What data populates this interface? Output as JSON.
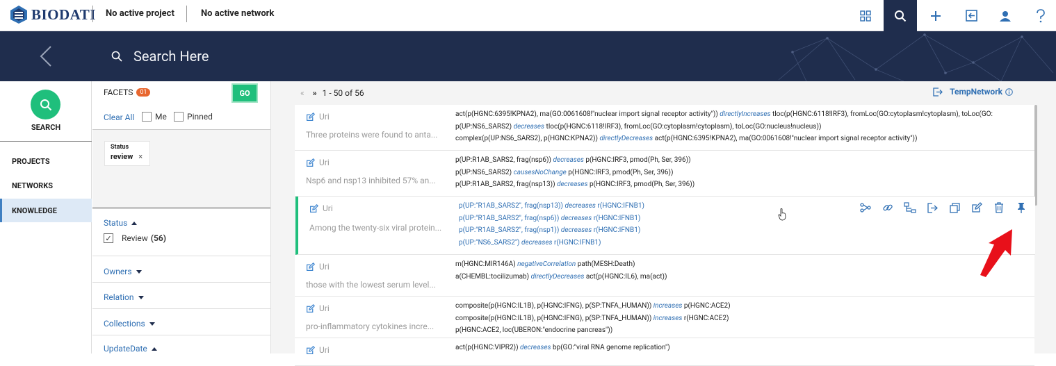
{
  "app": {
    "logo_text": "BIODATI",
    "project": "No active project",
    "network": "No active network"
  },
  "toolbar_icons": [
    "grid-icon",
    "search-icon",
    "plus-icon",
    "import-icon",
    "user-icon",
    "help-icon"
  ],
  "header": {
    "search_placeholder": "Search Here"
  },
  "leftnav": {
    "search_label": "SEARCH",
    "items": [
      {
        "label": "PROJECTS"
      },
      {
        "label": "NETWORKS"
      },
      {
        "label": "KNOWLEDGE"
      }
    ]
  },
  "facets": {
    "title": "FACETS",
    "count": "01",
    "go_label": "GO",
    "clear_all": "Clear All",
    "me_label": "Me",
    "pinned_label": "Pinned",
    "chip": {
      "key": "Status",
      "value": "review",
      "remove": "×"
    },
    "sections": [
      {
        "title": "Status",
        "expanded": true
      },
      {
        "title": "Owners",
        "expanded": false
      },
      {
        "title": "Relation",
        "expanded": false
      },
      {
        "title": "Collections",
        "expanded": false
      },
      {
        "title": "UpdateDate",
        "expanded": true
      }
    ],
    "status_option": {
      "label": "Review",
      "count": "(56)",
      "check": "✓"
    }
  },
  "results": {
    "pager_prev": "«",
    "pager_next": "»",
    "range": "1 - 50 of 56",
    "temp_network": "TempNetwork",
    "rows": [
      {
        "owner": "Uri",
        "summary": "Three proteins were found to anta...",
        "lines": [
          [
            {
              "t": "act(p(HGNC:6395!KPNA2), ma(GO:0061608!\"nuclear import signal receptor activity\")) "
            },
            {
              "t": "directlyIncreases",
              "rel": true
            },
            {
              "t": " tloc(p(HGNC:6118!IRF3), fromLoc(GO:cytoplasm!cytoplasm), toLoc(GO:"
            }
          ],
          [
            {
              "t": "p(UP:NS6_SARS2) "
            },
            {
              "t": "decreases",
              "rel": true
            },
            {
              "t": " tloc(p(HGNC:6118!IRF3), fromLoc(GO:cytoplasm!cytoplasm), toLoc(GO:nucleus!nucleus))"
            }
          ],
          [
            {
              "t": "complex(p(UP:NS6_SARS2), p(HGNC:KPNA2)) "
            },
            {
              "t": "directlyDecreases",
              "rel": true
            },
            {
              "t": " act(p(HGNC:6395!KPNA2), ma(GO:0061608!\"nuclear import signal receptor activity\"))"
            }
          ]
        ]
      },
      {
        "owner": "Uri",
        "summary": "Nsp6 and nsp13 inhibited 57% an...",
        "lines": [
          [
            {
              "t": "p(UP:R1AB_SARS2, frag(nsp6)) "
            },
            {
              "t": "decreases",
              "rel": true
            },
            {
              "t": " p(HGNC:IRF3, pmod(Ph, Ser, 396))"
            }
          ],
          [
            {
              "t": "p(UP:NS6_SARS2) "
            },
            {
              "t": "causesNoChange",
              "rel": true
            },
            {
              "t": " p(HGNC:IRF3, pmod(Ph, Ser, 396))"
            }
          ],
          [
            {
              "t": "p(UP:R1AB_SARS2, frag(nsp13)) "
            },
            {
              "t": "decreases",
              "rel": true
            },
            {
              "t": " p(HGNC:IRF3, pmod(Ph, Ser, 396))"
            }
          ]
        ]
      },
      {
        "owner": "Uri",
        "summary": "Among the twenty-six viral protein...",
        "active": true,
        "lines": [
          [
            {
              "t": "p(UP:\"R1AB_SARS2\", frag(nsp13)) "
            },
            {
              "t": "decreases",
              "rel": true
            },
            {
              "t": " r(HGNC:IFNB1)"
            }
          ],
          [
            {
              "t": "p(UP:\"R1AB_SARS2\", frag(nsp6)) "
            },
            {
              "t": "decreases",
              "rel": true
            },
            {
              "t": " r(HGNC:IFNB1)"
            }
          ],
          [
            {
              "t": "p(UP:\"R1AB_SARS2\", frag(nsp1)) "
            },
            {
              "t": "decreases",
              "rel": true
            },
            {
              "t": " r(HGNC:IFNB1)"
            }
          ],
          [
            {
              "t": "p(UP:\"NS6_SARS2\") "
            },
            {
              "t": "decreases",
              "rel": true
            },
            {
              "t": " r(HGNC:IFNB1)"
            }
          ]
        ],
        "actions": [
          "network-icon",
          "link-icon",
          "tree-icon",
          "export-icon",
          "copy-icon",
          "edit-icon",
          "trash-icon",
          "pin-icon"
        ]
      },
      {
        "owner": "Uri",
        "summary": "those with the lowest serum level...",
        "lines": [
          [
            {
              "t": "m(HGNC:MIR146A) "
            },
            {
              "t": "negativeCorrelation",
              "rel": true
            },
            {
              "t": " path(MESH:Death)"
            }
          ],
          [
            {
              "t": "a(CHEMBL:tocilizumab) "
            },
            {
              "t": "directlyDecreases",
              "rel": true
            },
            {
              "t": " act(p(HGNC:IL6), ma(act))"
            }
          ]
        ]
      },
      {
        "owner": "Uri",
        "summary": "pro-inflammatory cytokines incre...",
        "lines": [
          [
            {
              "t": "composite(p(HGNC:IL1B), p(HGNC:IFNG), p(SP:TNFA_HUMAN)) "
            },
            {
              "t": "increases",
              "rel": true
            },
            {
              "t": " p(HGNC:ACE2)"
            }
          ],
          [
            {
              "t": "composite(p(HGNC:IL1B), p(HGNC:IFNG), p(SP:TNFA_HUMAN)) "
            },
            {
              "t": "increases",
              "rel": true
            },
            {
              "t": " r(HGNC:ACE2)"
            }
          ],
          [
            {
              "t": "p(HGNC:ACE2, loc(UBERON:\"endocrine pancreas\"))"
            }
          ]
        ]
      },
      {
        "owner": "Uri",
        "summary": "",
        "lines": [
          [
            {
              "t": "act(p(HGNC:VIPR2)) "
            },
            {
              "t": "decreases",
              "rel": true
            },
            {
              "t": " bp(GO:\"viral RNA genome replication\")"
            }
          ]
        ]
      }
    ]
  },
  "colors": {
    "navy": "#1f2d4d",
    "green": "#1fbf7c",
    "blue": "#2f6fb3",
    "orange": "#e8672f",
    "red_arrow": "#e8101a"
  }
}
